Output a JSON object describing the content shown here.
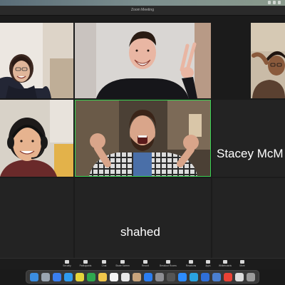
{
  "window": {
    "title": "Zoom Meeting"
  },
  "tiles": [
    {
      "id": "woman-glasses",
      "name": ""
    },
    {
      "id": "man-peace",
      "name": ""
    },
    {
      "id": "man-partial",
      "name": ""
    },
    {
      "id": "woman-headset",
      "name": ""
    },
    {
      "id": "man-shouting",
      "name": ""
    },
    {
      "id": "stacey",
      "name": "Stacey McM"
    },
    {
      "id": "empty-left",
      "name": ""
    },
    {
      "id": "shahed",
      "name": "shahed"
    },
    {
      "id": "empty-right",
      "name": ""
    }
  ],
  "controls": [
    {
      "label": "Security",
      "icon": "shield-icon"
    },
    {
      "label": "Participants",
      "icon": "participants-icon"
    },
    {
      "label": "Chat",
      "icon": "chat-icon"
    },
    {
      "label": "Share Screen",
      "icon": "share-screen-icon"
    },
    {
      "label": "Record",
      "icon": "record-icon"
    },
    {
      "label": "Breakout Rooms",
      "icon": "breakout-rooms-icon"
    },
    {
      "label": "Reactions",
      "icon": "reactions-icon"
    },
    {
      "label": "Apps",
      "icon": "apps-icon"
    },
    {
      "label": "Whiteboards",
      "icon": "whiteboard-icon"
    },
    {
      "label": "More",
      "icon": "more-icon"
    }
  ],
  "colors": {
    "active_speaker": "#39d353",
    "tile_bg": "#232323"
  },
  "dock": [
    {
      "icon": "finder-icon",
      "color": "#3b8de0"
    },
    {
      "icon": "launchpad-icon",
      "color": "#9aa5b1"
    },
    {
      "icon": "mail-icon",
      "color": "#3a7ff0"
    },
    {
      "icon": "safari-icon",
      "color": "#2e9bf0"
    },
    {
      "icon": "photos-icon",
      "color": "#e6d43a"
    },
    {
      "icon": "numbers-icon",
      "color": "#2fa84f"
    },
    {
      "icon": "notes-icon",
      "color": "#f0c64b"
    },
    {
      "icon": "calendar-icon",
      "color": "#f4f4f4"
    },
    {
      "icon": "preview-icon",
      "color": "#e9e9e9"
    },
    {
      "icon": "contacts-icon",
      "color": "#c8a47c"
    },
    {
      "icon": "app-store-icon",
      "color": "#2b7df0"
    },
    {
      "icon": "settings-icon",
      "color": "#8e8e93"
    },
    {
      "icon": "calculator-icon",
      "color": "#555555"
    },
    {
      "icon": "zoom-icon",
      "color": "#2d8cff"
    },
    {
      "icon": "telegram-icon",
      "color": "#2aa3e0"
    },
    {
      "icon": "screens-icon",
      "color": "#2f6fd9"
    },
    {
      "icon": "finder-window-icon",
      "color": "#4b7fcf"
    },
    {
      "icon": "chrome-icon",
      "color": "#e94235"
    },
    {
      "icon": "document-icon",
      "color": "#dcdcdc"
    },
    {
      "icon": "trash-icon",
      "color": "#9a9a9a"
    }
  ]
}
